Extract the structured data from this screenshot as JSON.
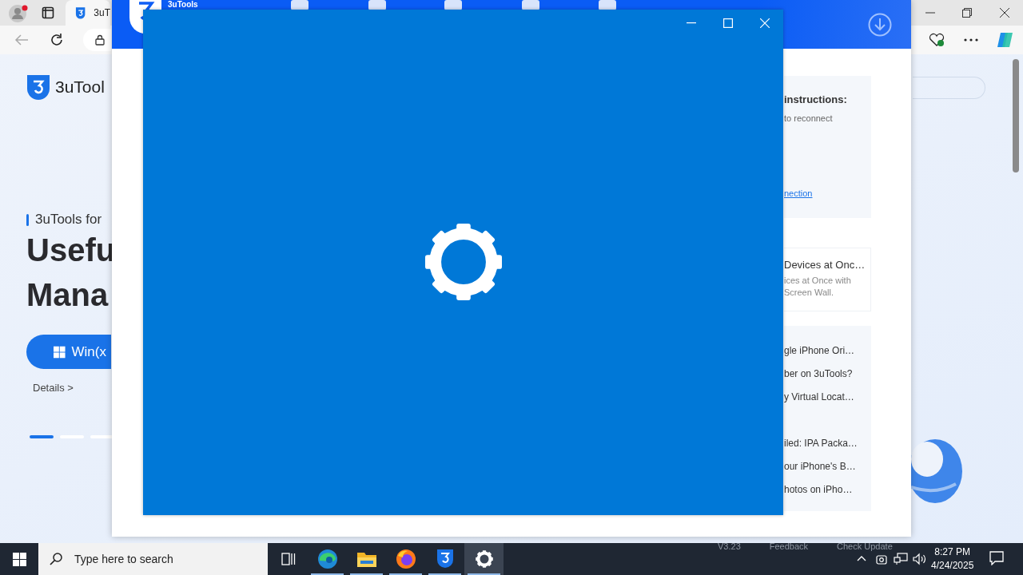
{
  "browser": {
    "tab_title": "3uT",
    "page": {
      "logo_text": "3uTool",
      "eyebrow": "3uTools for",
      "headline": [
        "Usefu",
        "Mana"
      ],
      "download_button": "Win(x",
      "details_link": "Details >",
      "carousel": [
        {
          "selected": true
        },
        {
          "selected": false
        },
        {
          "selected": false
        }
      ]
    }
  },
  "app_window": {
    "title": "3uTools",
    "instructions": {
      "heading": "instructions:",
      "text": "to reconnect",
      "link": "nection"
    },
    "feature_card": {
      "title": "Devices at Onc…",
      "description": [
        "ices at Once with",
        "Screen Wall."
      ]
    },
    "articles": [
      {
        "title": "gle iPhone Ori…"
      },
      {
        "title": "ber on 3uTools?"
      },
      {
        "title": "y Virtual Locat…"
      },
      {
        "title": "iled: IPA Packa…",
        "gap_before": true
      },
      {
        "title": "our iPhone's B…"
      },
      {
        "title": "hotos on iPho…"
      }
    ],
    "status_bar": [
      "V3.23",
      "Feedback",
      "Check Update"
    ]
  },
  "taskbar": {
    "search_placeholder": "Type here to search",
    "apps": [
      {
        "kind": "taskview",
        "selected": false
      },
      {
        "kind": "edge",
        "selected": false
      },
      {
        "kind": "explorer",
        "selected": false
      },
      {
        "kind": "firefox",
        "selected": false
      },
      {
        "kind": "threeu",
        "selected": false
      },
      {
        "kind": "settings",
        "selected": true
      }
    ],
    "time": "8:27 PM",
    "date": "4/24/2025"
  }
}
